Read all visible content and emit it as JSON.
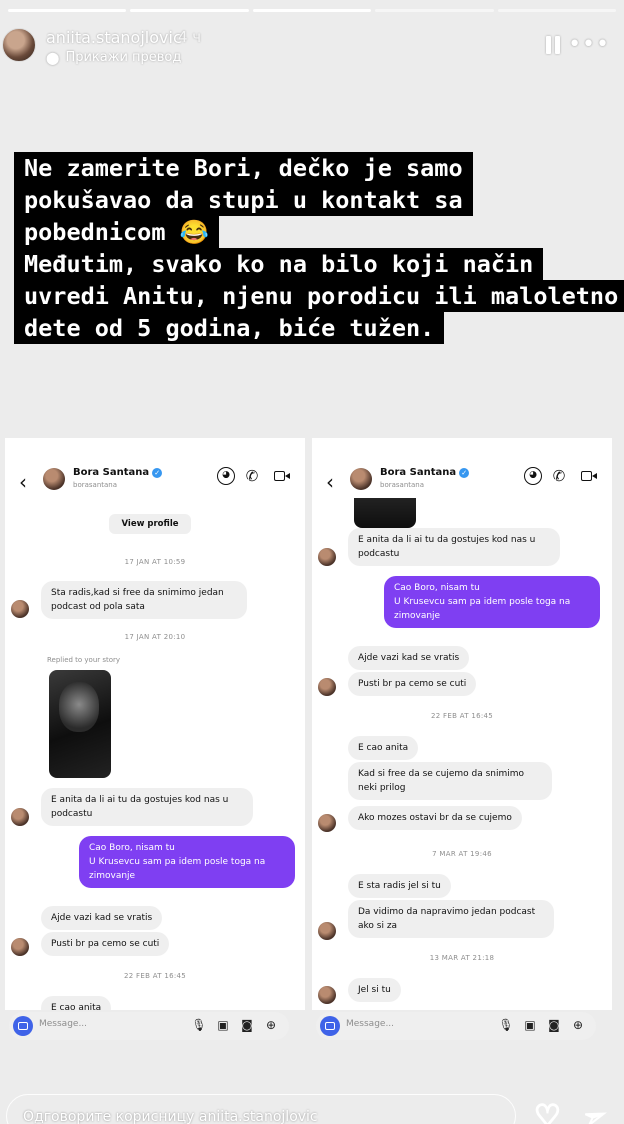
{
  "story": {
    "progress_segments": [
      true,
      true,
      true,
      false,
      false
    ],
    "username": "aniita.stanojlovic",
    "time_ago": "4 ч",
    "translate_label": "Прикажи превод",
    "caption_lines": [
      "Ne zamerite Bori, dečko je samo",
      "pokušavao da stupi u kontakt sa",
      "pobednicom 😂",
      "Međutim, svako ko na bilo koji način",
      "uvredi Anitu, njenu porodicu ili maloletno",
      "dete od 5 godina, biće tužen."
    ],
    "reply_placeholder": "Одговорите корисницу aniita.stanojlovic",
    "icons": {
      "pause": "pause-icon",
      "more": "more-icon",
      "heart": "heart-icon",
      "send": "send-icon"
    }
  },
  "chat_left": {
    "name": "Bora Santana",
    "handle": "borasantana",
    "view_profile": "View profile",
    "stamp_1": "17 JAN AT 10:59",
    "msg_1a": "Sta radis,kad si free da snimimo jedan",
    "msg_1b": "podcast  od pola sata",
    "stamp_2": "17 JAN AT 20:10",
    "replied_label": "Replied to your story",
    "msg_2a": "E anita da li ai tu da gostujes kod nas u",
    "msg_2b": "podcastu",
    "out_1a": "Cao Boro, nisam tu",
    "out_1b": "U Krusevcu sam pa idem posle toga na",
    "out_1c": "zimovanje",
    "msg_3": "Ajde vazi kad se vratis",
    "msg_4": "Pusti br pa cemo se cuti",
    "stamp_3": "22 FEB AT 16:45",
    "msg_5": "E cao anita",
    "composer_placeholder": "Message..."
  },
  "chat_right": {
    "name": "Bora Santana",
    "handle": "borasantana",
    "msg_1a": "E anita da li ai tu da gostujes kod nas u",
    "msg_1b": "podcastu",
    "out_1a": "Cao Boro, nisam tu",
    "out_1b": "U Krusevcu sam pa idem posle toga na",
    "out_1c": "zimovanje",
    "msg_2": "Ajde vazi kad se vratis",
    "msg_3": "Pusti br pa cemo se cuti",
    "stamp_1": "22 FEB AT 16:45",
    "msg_4": "E cao anita",
    "msg_5a": "Kad si free da se cujemo da snimimo",
    "msg_5b": "neki prilog",
    "msg_6": "Ako mozes ostavi br da se cujemo",
    "stamp_2": "7 MAR AT 19:46",
    "msg_7": "E sta radis jel si tu",
    "msg_8a": "Da vidimo da napravimo jedan podcast",
    "msg_8b": "ako si za",
    "stamp_3": "13 MAR AT 21:18",
    "msg_9": "Jel si tu",
    "composer_placeholder": "Message..."
  },
  "colors": {
    "outgoing_bubble": "#7f3ff2",
    "incoming_bubble": "#efefef",
    "caption_bg": "#000000",
    "verified": "#3797f0"
  }
}
